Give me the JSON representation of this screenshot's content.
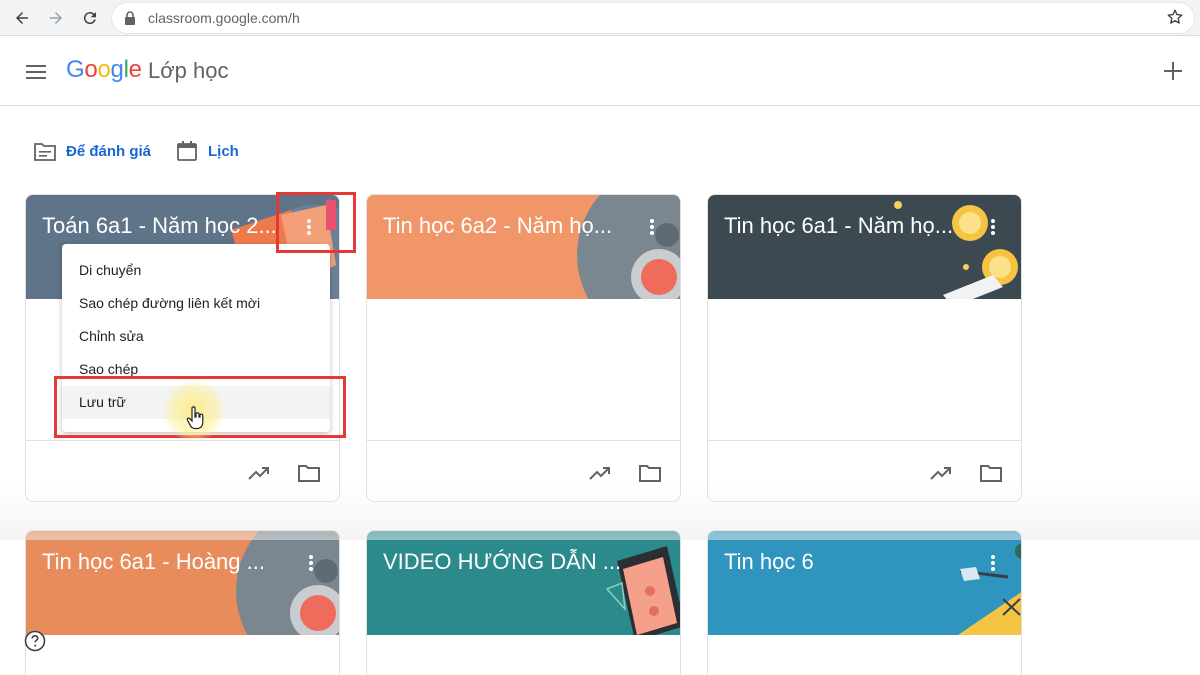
{
  "browser": {
    "url": "classroom.google.com/h"
  },
  "header": {
    "logo_text": "Google",
    "product_name": "Lớp học"
  },
  "subnav": {
    "review_label": "Để đánh giá",
    "calendar_label": "Lịch"
  },
  "cards": [
    {
      "title": "Toán 6a1 - Năm học 2...",
      "color": "#5f7389"
    },
    {
      "title": "Tin học 6a2 - Năm họ...",
      "color": "#f09668"
    },
    {
      "title": "Tin học 6a1 - Năm họ...",
      "color": "#3c4950"
    },
    {
      "title": "Tin học 6a1 - Hoàng ...",
      "color": "#e88c5c"
    },
    {
      "title": "VIDEO HƯỚNG DẪN ...",
      "color": "#2a8a8c"
    },
    {
      "title": "Tin học 6",
      "color": "#2f95bf"
    }
  ],
  "context_menu": {
    "items": [
      "Di chuyển",
      "Sao chép đường liên kết mời",
      "Chỉnh sửa",
      "Sao chép",
      "Lưu trữ"
    ]
  },
  "colors": {
    "accent_blue": "#1967d2",
    "highlight_red": "#e53935"
  }
}
